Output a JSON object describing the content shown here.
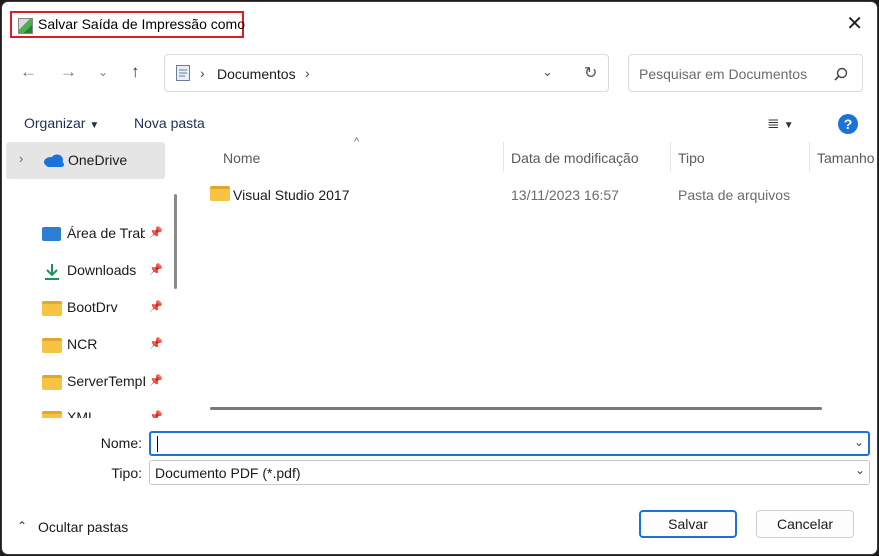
{
  "window": {
    "title": "Salvar Saída de Impressão como"
  },
  "nav": {
    "back_icon": "arrow-left-icon",
    "forward_icon": "arrow-right-icon",
    "recent_icon": "chevron-down-icon",
    "up_icon": "arrow-up-icon"
  },
  "address": {
    "location": "Documentos"
  },
  "search": {
    "placeholder": "Pesquisar em Documentos"
  },
  "toolbar": {
    "organize_label": "Organizar",
    "new_folder_label": "Nova pasta"
  },
  "sidebar": {
    "onedrive_label": "OneDrive",
    "items": [
      {
        "label": "Área de Trabalho",
        "icon": "desktop-icon"
      },
      {
        "label": "Downloads",
        "icon": "download-icon"
      },
      {
        "label": "BootDrv",
        "icon": "folder-icon"
      },
      {
        "label": "NCR",
        "icon": "folder-icon"
      },
      {
        "label": "ServerTempD",
        "icon": "folder-icon"
      },
      {
        "label": "XML",
        "icon": "folder-icon"
      }
    ]
  },
  "file_list": {
    "columns": [
      "Nome",
      "Data de modificação",
      "Tipo",
      "Tamanho"
    ],
    "rows": [
      {
        "name": "Visual Studio 2017",
        "modified": "13/11/2023 16:57",
        "type": "Pasta de arquivos"
      }
    ]
  },
  "form": {
    "name_label": "Nome:",
    "name_value": "",
    "type_label": "Tipo:",
    "type_value": "Documento PDF (*.pdf)"
  },
  "footer": {
    "hide_folders_label": "Ocultar pastas",
    "save_label": "Salvar",
    "cancel_label": "Cancelar"
  },
  "colors": {
    "accent": "#1a73d9",
    "highlight_border": "#e01b24",
    "folder": "#f6c343"
  }
}
